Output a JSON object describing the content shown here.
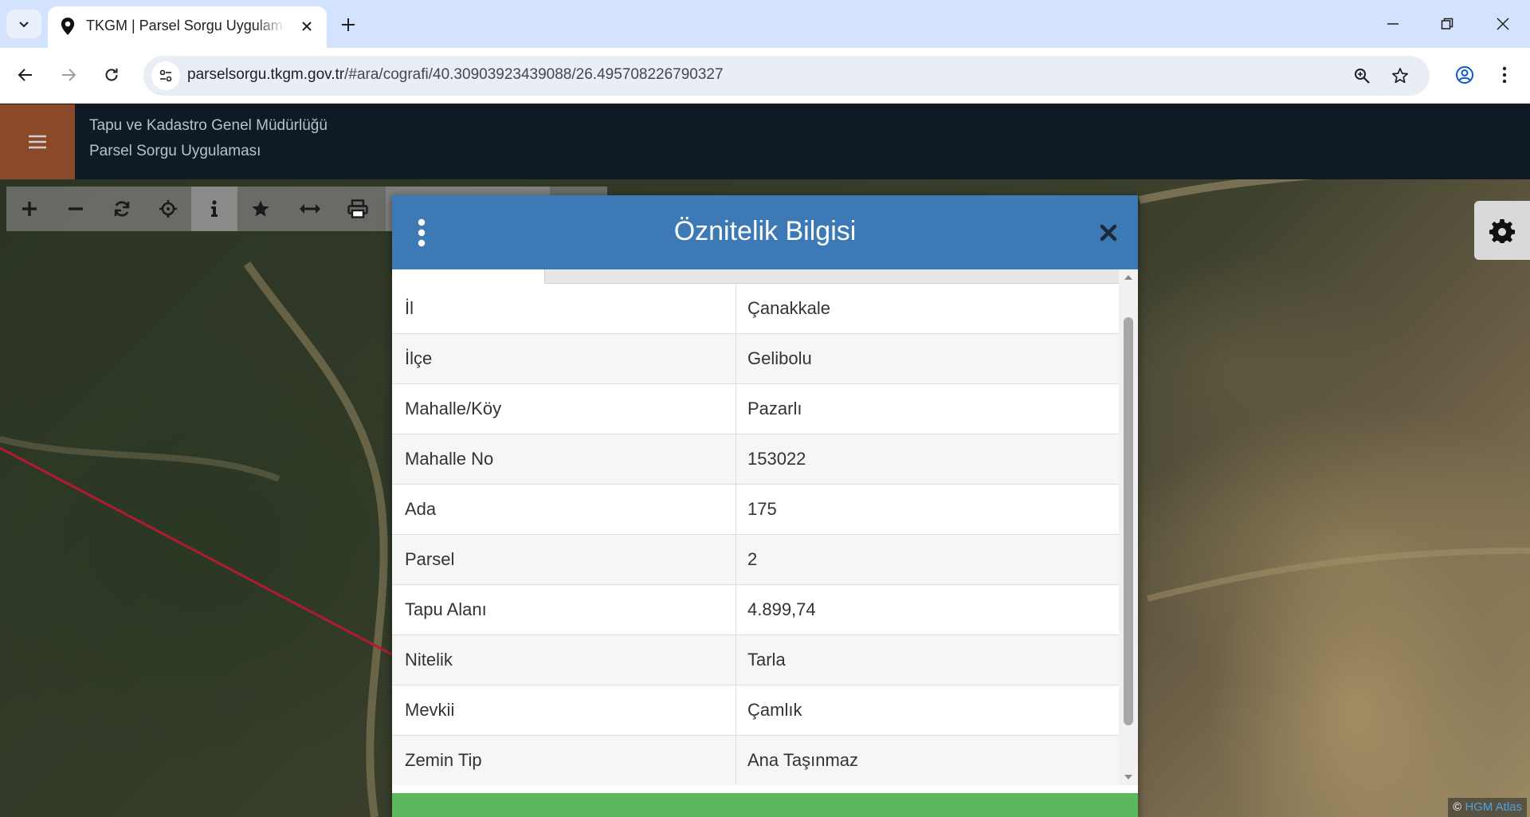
{
  "browser": {
    "tab_title": "TKGM | Parsel Sorgu Uygulaması",
    "url_host": "parselsorgu.tkgm.gov.tr",
    "url_path": "/#ara/cografi/40.30903923439088/26.495708226790327",
    "icons": [
      "tab-search-icon",
      "location-pin-icon",
      "close-icon",
      "plus-icon",
      "minimize-icon",
      "restore-icon",
      "close-window-icon",
      "back-arrow-icon",
      "forward-arrow-icon",
      "reload-icon",
      "site-info-icon",
      "zoom-icon",
      "star-icon",
      "profile-icon",
      "more-vert-icon"
    ]
  },
  "header": {
    "org_name": "Tapu ve Kadastro Genel Müdürlüğü",
    "app_name": "Parsel Sorgu Uygulaması",
    "menu_icon": "hamburger-icon",
    "menu_color": "#8a4a2a"
  },
  "map_tools": [
    "zoom-in-icon",
    "zoom-out-icon",
    "refresh-icon",
    "locate-icon",
    "info-icon",
    "star-icon",
    "measure-icon",
    "print-icon"
  ],
  "dialog": {
    "title": "Öznitelik Bilgisi",
    "header_color": "#3d7ab5",
    "footer_color": "#5cb85c",
    "rows": [
      {
        "key": "İl",
        "value": "Çanakkale"
      },
      {
        "key": "İlçe",
        "value": "Gelibolu"
      },
      {
        "key": "Mahalle/Köy",
        "value": "Pazarlı"
      },
      {
        "key": "Mahalle No",
        "value": "153022"
      },
      {
        "key": "Ada",
        "value": "175"
      },
      {
        "key": "Parsel",
        "value": "2"
      },
      {
        "key": "Tapu Alanı",
        "value": "4.899,74"
      },
      {
        "key": "Nitelik",
        "value": "Tarla"
      },
      {
        "key": "Mevkii",
        "value": "Çamlık"
      },
      {
        "key": "Zemin Tip",
        "value": "Ana Taşınmaz"
      }
    ]
  },
  "map": {
    "copyright_symbol": "©",
    "copyright_link": "HGM Atlas",
    "parcel_line_color": "#b01c2e"
  }
}
